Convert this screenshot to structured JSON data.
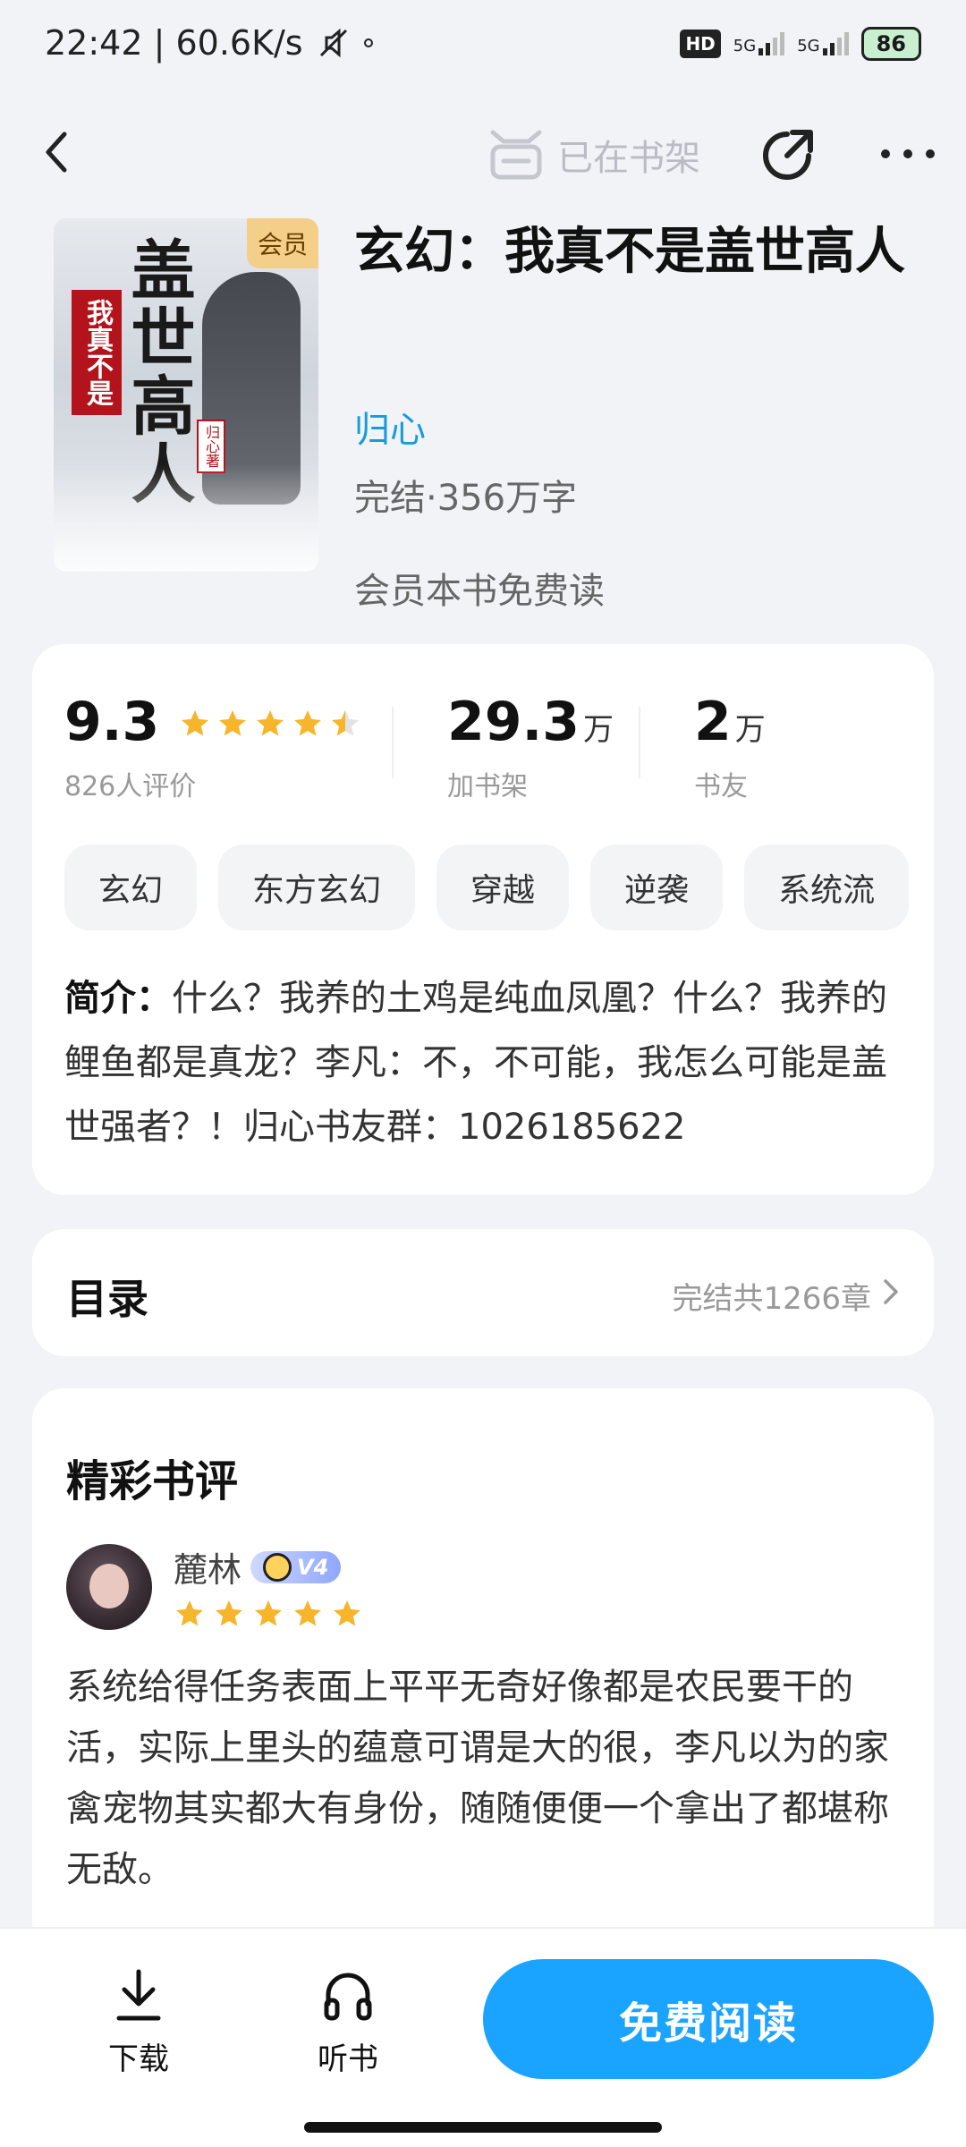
{
  "status_bar": {
    "time_speed": "22:42 | 60.6K/s",
    "hd": "HD",
    "net1": "5G",
    "net2": "5G",
    "battery": "86"
  },
  "topnav": {
    "shelf_label": "已在书架"
  },
  "book": {
    "title": "玄幻：我真不是盖世高人",
    "author": "归心",
    "meta": "完结·356万字",
    "vip_free": "会员本书免费读",
    "cover": {
      "vip_tag": "会员",
      "big_title": "盖世高人",
      "small_title": "我真不是",
      "author_seal": "归心著"
    }
  },
  "stats": {
    "rating": {
      "value": "9.3",
      "label": "826人评价",
      "stars": 4.5
    },
    "shelf": {
      "value": "29.3",
      "unit": "万",
      "label": "加书架"
    },
    "friends": {
      "value": "2",
      "unit": "万",
      "label": "书友"
    }
  },
  "tags": [
    "玄幻",
    "东方玄幻",
    "穿越",
    "逆袭",
    "系统流"
  ],
  "intro": {
    "label": "简介：",
    "text": "什么？我养的土鸡是纯血凤凰？什么？我养的鲤鱼都是真龙？李凡：不，不可能，我怎么可能是盖世强者？！归心书友群：1026185622"
  },
  "toc": {
    "title": "目录",
    "count": "完结共1266章"
  },
  "reviews": {
    "title": "精彩书评",
    "items": [
      {
        "name": "麓林",
        "level": "V4",
        "stars": 5,
        "text": "系统给得任务表面上平平无奇好像都是农民要干的活，实际上里头的蕴意可谓是大的很，李凡以为的家禽宠物其实都大有身份，随随便便一个拿出了都堪称无敌。"
      }
    ]
  },
  "bottom": {
    "download": "下载",
    "listen": "听书",
    "read": "免费阅读"
  },
  "colors": {
    "accent": "#1aa3ff",
    "author_link": "#1a9bd8",
    "star": "#f7b52c"
  }
}
